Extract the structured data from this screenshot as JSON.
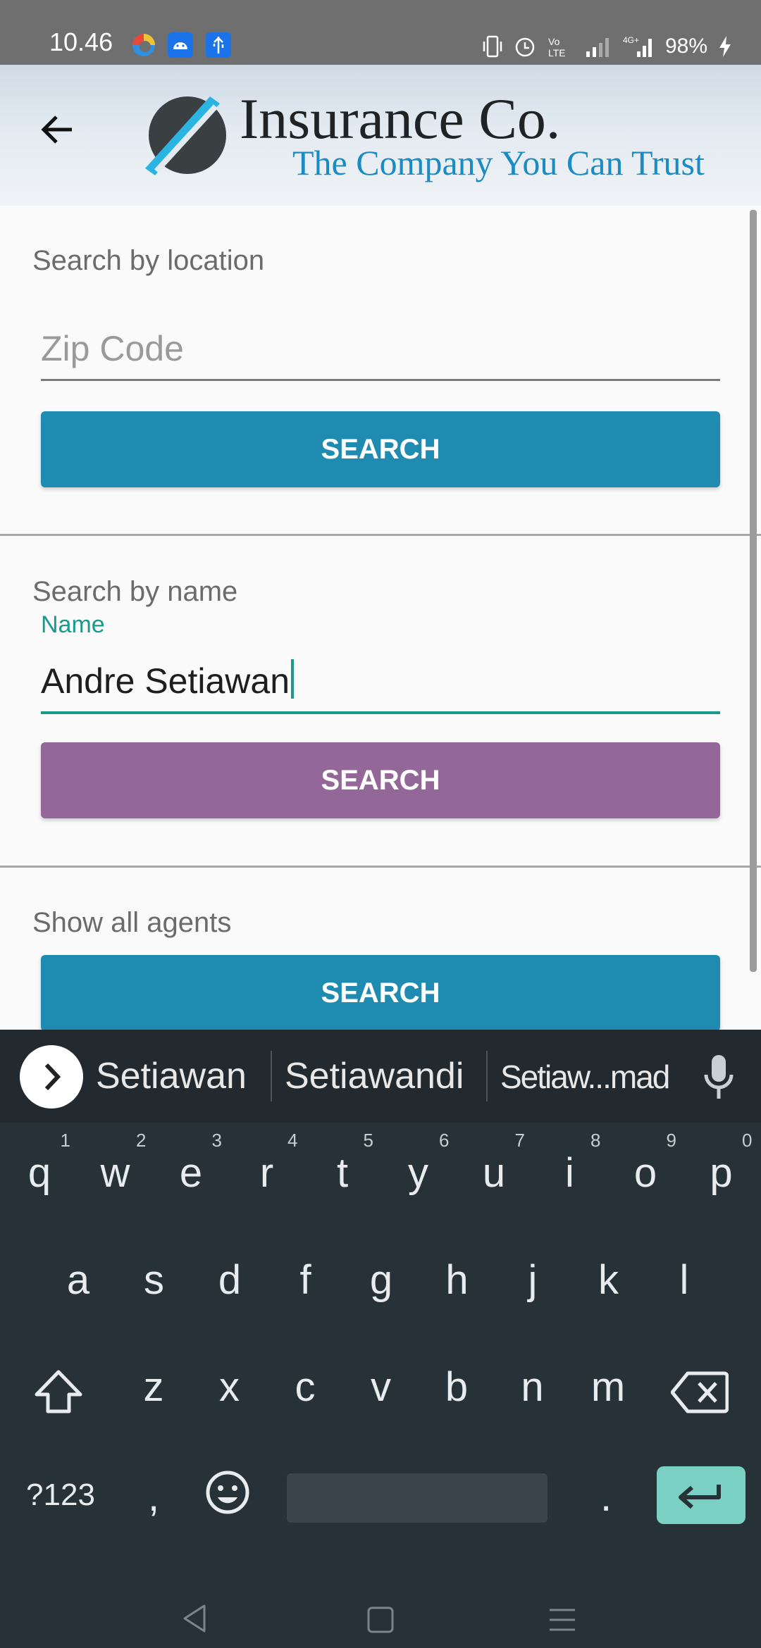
{
  "status_bar": {
    "time": "10.46",
    "battery": "98%",
    "network": "4G"
  },
  "header": {
    "brand_title": "Insurance Co.",
    "brand_tagline": "The Company You Can Trust"
  },
  "location_section": {
    "label": "Search by location",
    "zip_placeholder": "Zip Code",
    "button": "SEARCH"
  },
  "name_section": {
    "label": "Search by name",
    "field_label": "Name",
    "field_value": "Andre Setiawan",
    "button": "SEARCH"
  },
  "agents_section": {
    "label": "Show all agents",
    "button": "SEARCH"
  },
  "keyboard": {
    "suggestions": [
      "Setiawan",
      "Setiawandi",
      "Setiaw...mad"
    ],
    "row1": [
      {
        "k": "q",
        "n": "1"
      },
      {
        "k": "w",
        "n": "2"
      },
      {
        "k": "e",
        "n": "3"
      },
      {
        "k": "r",
        "n": "4"
      },
      {
        "k": "t",
        "n": "5"
      },
      {
        "k": "y",
        "n": "6"
      },
      {
        "k": "u",
        "n": "7"
      },
      {
        "k": "i",
        "n": "8"
      },
      {
        "k": "o",
        "n": "9"
      },
      {
        "k": "p",
        "n": "0"
      }
    ],
    "row2": [
      "a",
      "s",
      "d",
      "f",
      "g",
      "h",
      "j",
      "k",
      "l"
    ],
    "row3": [
      "z",
      "x",
      "c",
      "v",
      "b",
      "n",
      "m"
    ],
    "symbols_key": "?123",
    "comma_key": ",",
    "period_key": "."
  },
  "colors": {
    "primary_button": "#1f8bb0",
    "pressed_button": "#936798",
    "accent": "#1a9a8a",
    "enter_key": "#7ad1c3"
  },
  "icons": [
    "back-arrow-icon",
    "chevron-right-icon",
    "microphone-icon",
    "shift-icon",
    "backspace-icon",
    "emoji-icon",
    "enter-icon"
  ]
}
